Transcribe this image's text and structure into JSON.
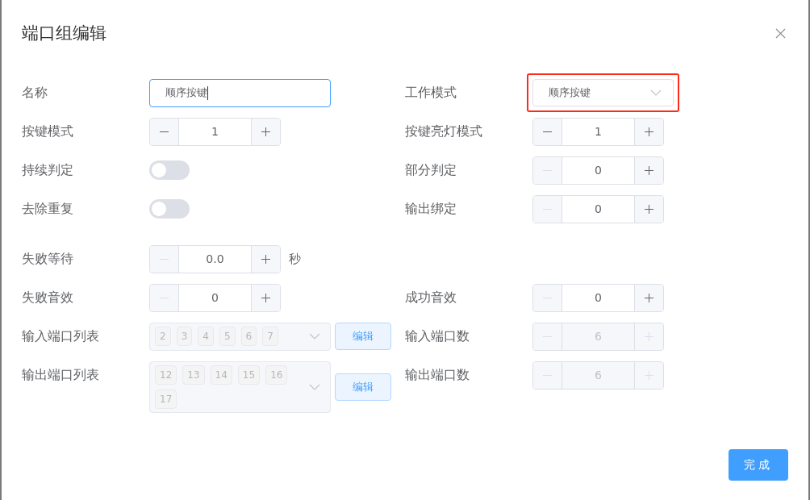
{
  "dialog": {
    "title": "端口组编辑",
    "sections": [
      [
        {
          "left": {
            "kind": "input",
            "label": "名称",
            "value": "顺序按键",
            "focused": true
          },
          "right": {
            "kind": "select",
            "label": "工作模式",
            "value": "顺序按键",
            "highlighted": true
          }
        },
        {
          "left": {
            "kind": "stepper",
            "label": "按键模式",
            "value": "1",
            "minus_disabled": false,
            "disabled": false
          },
          "right": {
            "kind": "stepper",
            "label": "按键亮灯模式",
            "value": "1",
            "minus_disabled": false,
            "disabled": false
          }
        },
        {
          "left": {
            "kind": "switch",
            "label": "持续判定",
            "on": false
          },
          "right": {
            "kind": "stepper",
            "label": "部分判定",
            "value": "0",
            "minus_disabled": true,
            "disabled": false
          }
        },
        {
          "left": {
            "kind": "switch",
            "label": "去除重复",
            "on": false
          },
          "right": {
            "kind": "stepper",
            "label": "输出绑定",
            "value": "0",
            "minus_disabled": true,
            "disabled": false
          }
        }
      ],
      [
        {
          "left": {
            "kind": "stepper",
            "label": "失败等待",
            "value": "0.0",
            "minus_disabled": true,
            "disabled": false,
            "unit": "秒"
          }
        },
        {
          "left": {
            "kind": "stepper",
            "label": "失败音效",
            "value": "0",
            "minus_disabled": true,
            "disabled": false
          },
          "right": {
            "kind": "stepper",
            "label": "成功音效",
            "value": "0",
            "minus_disabled": true,
            "disabled": false
          }
        },
        {
          "left": {
            "kind": "tags",
            "label": "输入端口列表",
            "tags": [
              "2",
              "3",
              "4",
              "5",
              "6",
              "7"
            ],
            "disabled": true,
            "button": "编辑"
          },
          "right": {
            "kind": "stepper",
            "label": "输入端口数",
            "value": "6",
            "disabled": true
          }
        },
        {
          "left": {
            "kind": "tags",
            "label": "输出端口列表",
            "tags": [
              "12",
              "13",
              "14",
              "15",
              "16",
              "17"
            ],
            "disabled": true,
            "button": "编辑"
          },
          "right": {
            "kind": "stepper",
            "label": "输出端口数",
            "value": "6",
            "disabled": true
          }
        }
      ]
    ],
    "confirm_button": "完成"
  }
}
